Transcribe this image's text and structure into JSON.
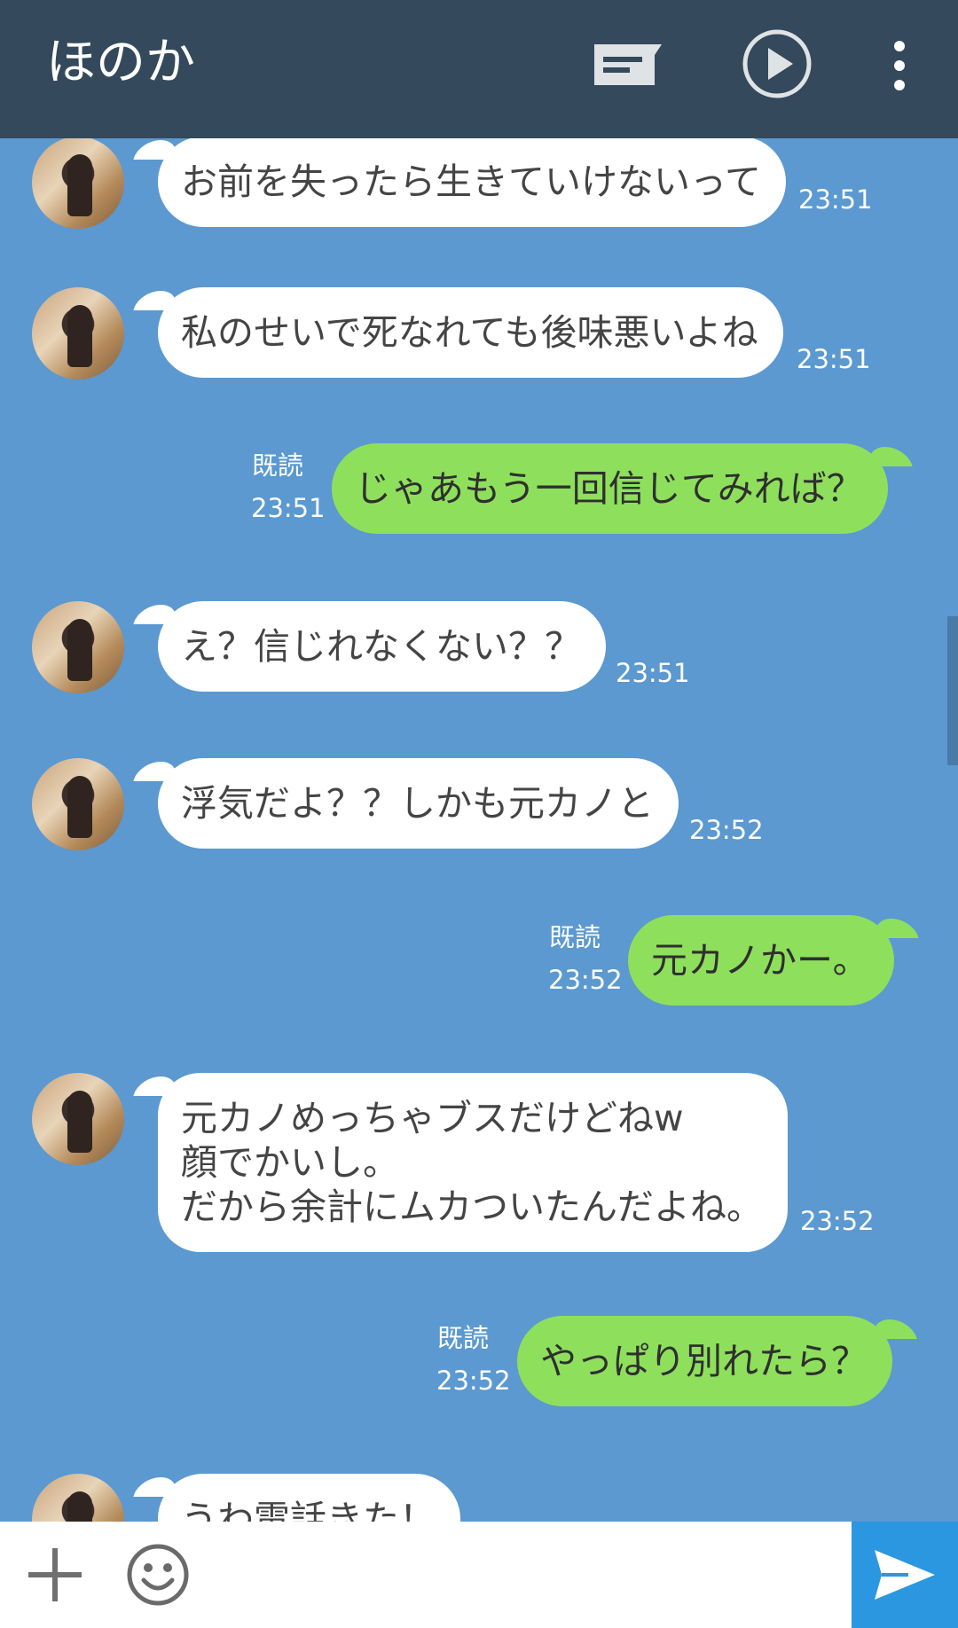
{
  "header": {
    "title": "ほのか"
  },
  "messages": [
    {
      "dir": "in",
      "text": "お前を失ったら生きていけないって",
      "time": "23:51"
    },
    {
      "dir": "in",
      "text": "私のせいで死なれても後味悪いよね",
      "time": "23:51"
    },
    {
      "dir": "out",
      "text": "じゃあもう一回信じてみれば？",
      "time": "23:51",
      "read": "既読"
    },
    {
      "dir": "in",
      "text": "え？信じれなくない？？",
      "time": "23:51"
    },
    {
      "dir": "in",
      "text": "浮気だよ？？しかも元カノと",
      "time": "23:52"
    },
    {
      "dir": "out",
      "text": "元カノかー。",
      "time": "23:52",
      "read": "既読"
    },
    {
      "dir": "in",
      "text": "元カノめっちゃブスだけどねw\n顔でかいし。\nだから余計にムカついたんだよね。",
      "time": "23:52"
    },
    {
      "dir": "out",
      "text": "やっぱり別れたら？",
      "time": "23:52",
      "read": "既読"
    },
    {
      "dir": "in",
      "text": "うわ電話きた！",
      "time": ""
    }
  ],
  "composer": {
    "placeholder": ""
  },
  "icons": {
    "notes": "notes-icon",
    "play": "play-circle-icon",
    "menu": "more-vert-icon",
    "plus": "plus-icon",
    "emoji": "smile-icon",
    "send": "send-icon"
  },
  "colors": {
    "header_bg": "#34495b",
    "chat_bg": "#5b99d0",
    "incoming_bubble": "#ffffff",
    "outgoing_bubble": "#8ee05c",
    "send_button": "#2a97e0"
  }
}
